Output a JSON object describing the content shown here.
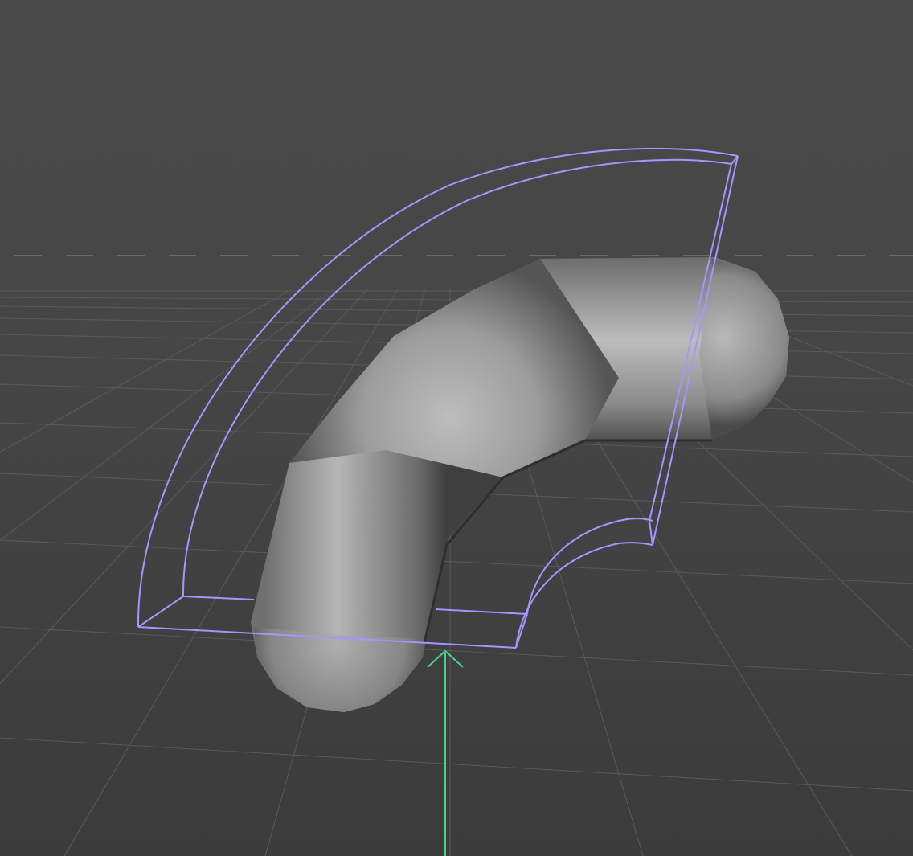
{
  "viewport": {
    "view": "perspective",
    "background_top_color": "#484848",
    "background_floor_color": "#3d3d3d"
  },
  "grid": {
    "visible": true,
    "line_color": "#5a5a5a",
    "axis_color": "#6c6c6c",
    "horizon_style": "dashed"
  },
  "object": {
    "type": "bent-tube",
    "shading": "smooth-gray",
    "highlight_color": "#bdbdbd",
    "shadow_color": "#4a4a4a"
  },
  "deformer_cage": {
    "type": "bend-cage",
    "color": "#a794ff"
  },
  "manipulator": {
    "type": "translate-arrow",
    "axis": "y",
    "color": "#4dd08a"
  }
}
